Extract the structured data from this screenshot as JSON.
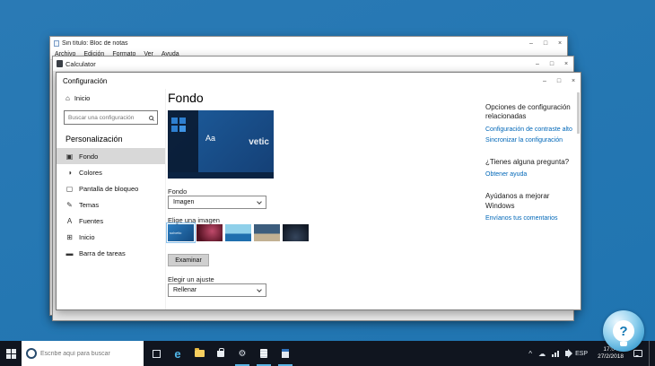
{
  "colors": {
    "desktop": "#1f74b0",
    "taskbar": "#10151f",
    "accent": "#0078d7",
    "link": "#0067b8"
  },
  "icons": {
    "minimize": "–",
    "maximize": "□",
    "close": "×",
    "home": "⌂",
    "tray_expand": "^",
    "cloud": "☁",
    "gear": "⚙"
  },
  "notepad": {
    "title": "Sin título: Bloc de notas",
    "menus": [
      "Archivo",
      "Edición",
      "Formato",
      "Ver",
      "Ayuda"
    ]
  },
  "calculator": {
    "title": "Calculator"
  },
  "settings": {
    "title": "Configuración",
    "sidebar": {
      "home_label": "Inicio",
      "search_placeholder": "Buscar una configuración",
      "section_title": "Personalización",
      "items": [
        {
          "icon": "▣",
          "label": "Fondo"
        },
        {
          "icon": "◑",
          "label": "Colores"
        },
        {
          "icon": "▢",
          "label": "Pantalla de bloqueo"
        },
        {
          "icon": "✎",
          "label": "Temas"
        },
        {
          "icon": "A",
          "label": "Fuentes"
        },
        {
          "icon": "⊞",
          "label": "Inicio"
        },
        {
          "icon": "▬",
          "label": "Barra de tareas"
        }
      ]
    },
    "main": {
      "page_title": "Fondo",
      "preview": {
        "sample": "Aa",
        "watermark": "vetic"
      },
      "background_label": "Fondo",
      "background_value": "Imagen",
      "choose_image_label": "Elige una imagen",
      "thumb_watermark": "solvetic",
      "browse_button": "Examinar",
      "fit_label": "Elegir un ajuste",
      "fit_value": "Rellenar"
    },
    "related": {
      "title": "Opciones de configuración relacionadas",
      "link_contrast": "Configuración de contraste alto",
      "link_sync": "Sincronizar la configuración",
      "question_title": "¿Tienes alguna pregunta?",
      "question_link": "Obtener ayuda",
      "improve_title": "Ayúdanos a mejorar Windows",
      "improve_link": "Envíanos tus comentarios"
    }
  },
  "taskbar": {
    "search_placeholder": "Escribe aquí para buscar",
    "lang": "ESP",
    "time": "17:04",
    "date": "27/2/2018"
  }
}
